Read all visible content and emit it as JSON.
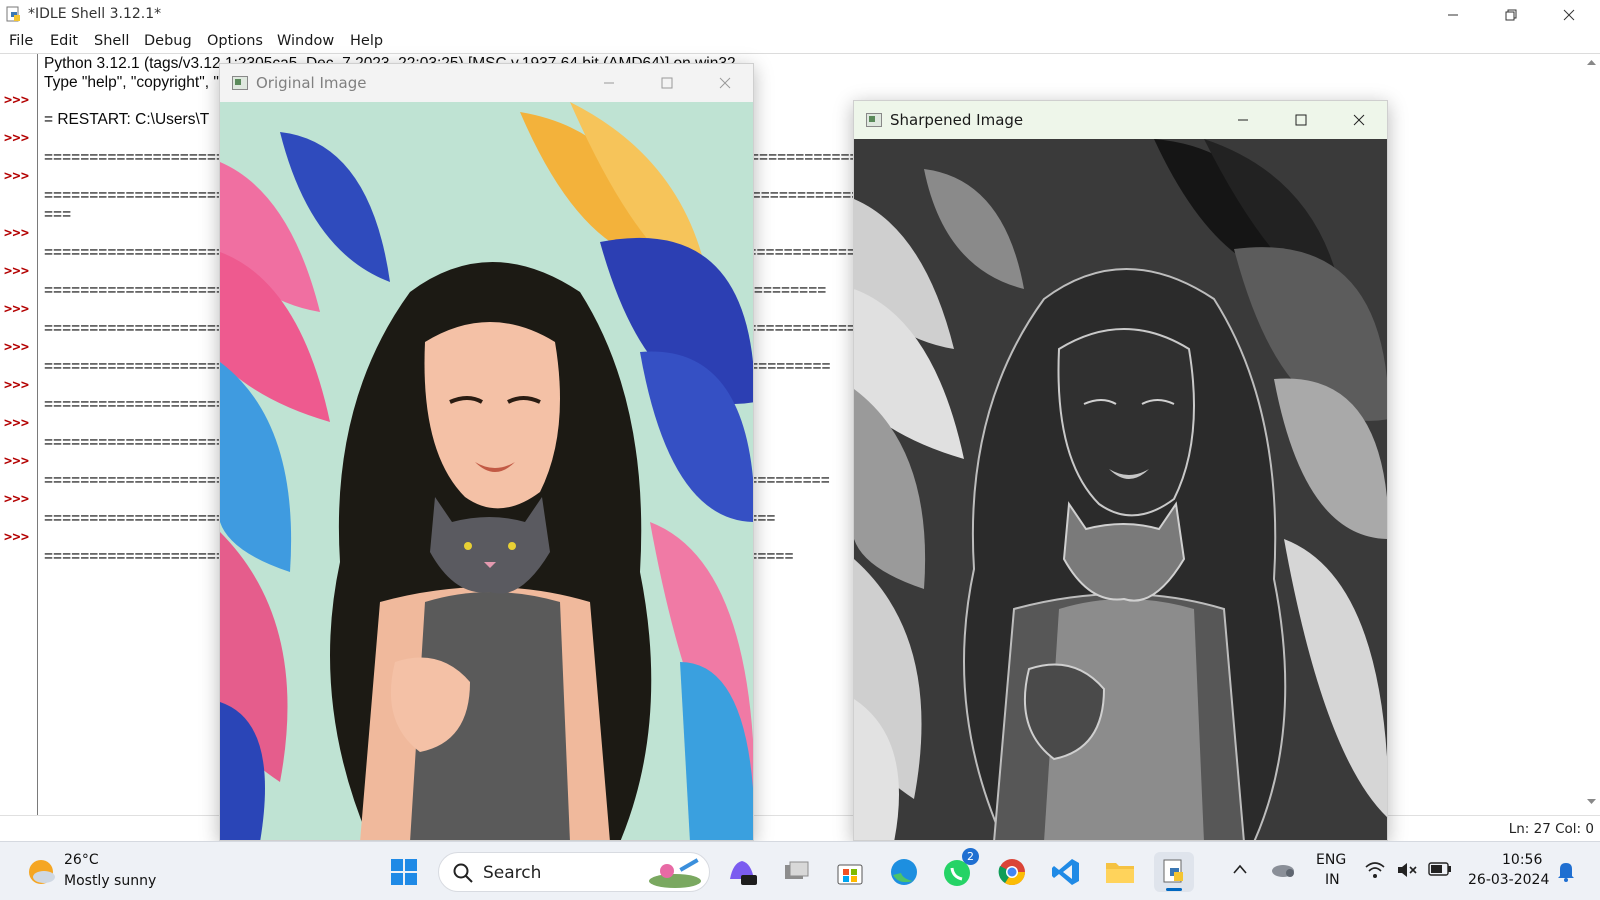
{
  "idle": {
    "title": "*IDLE Shell 3.12.1*",
    "menu": [
      "File",
      "Edit",
      "Shell",
      "Debug",
      "Options",
      "Window",
      "Help"
    ],
    "prompt": ">>>",
    "lines": [
      "Python 3.12.1 (tags/v3.12.1:2305ca5, Dec  7 2023, 22:03:25) [MSC v.1937 64 bit (AMD64)] on win32",
      "Type \"help\", \"copyright\", \"credits\" or \"license()\" for more information.",
      "= RESTART: C:\\Users\\T",
      "================================ esktop\\cv\\15.d ================================================",
      "================================ eja\\Desktop\\cv ===================================================",
      "===",
      "================================ op\\cv\\17.edge ===============================================",
      "================================ \\18.edge dete ===========================================",
      "================================ op\\cv\\19.edge ================================================",
      "================================ 20.shrpening ( ===========================================",
      "================================ k implementatc ====================",
      "================================ aplacian mask ==========================",
      "================================ 23.sharpening ===========================================",
      "================================ 4.shrpening of =====================================",
      "================================ 25.sharpening ======================================="
    ],
    "status": "Ln: 27   Col: 0"
  },
  "windows": {
    "original": {
      "title": "Original Image"
    },
    "sharpened": {
      "title": "Sharpened Image"
    }
  },
  "taskbar": {
    "weather_temp": "26°C",
    "weather_desc": "Mostly sunny",
    "search_label": "Search",
    "whatsapp_badge": "2",
    "lang_top": "ENG",
    "lang_bottom": "IN",
    "time": "10:56",
    "date": "26-03-2024",
    "icons": [
      "windows-start-icon",
      "copilot-icon",
      "task-view-icon",
      "microsoft-store-icon",
      "edge-icon",
      "whatsapp-icon",
      "chrome-icon",
      "vscode-icon",
      "file-explorer-icon",
      "idle-python-icon"
    ]
  },
  "colors": {
    "prompt": "#b30000",
    "accent": "#0067c0",
    "sharpened_titlebar": "#eef6ea"
  }
}
